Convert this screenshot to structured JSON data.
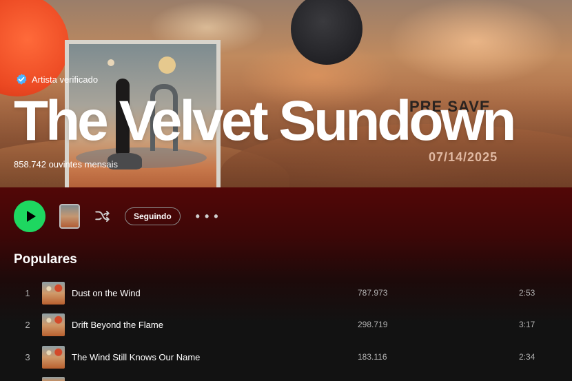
{
  "artist": {
    "verified_label": "Artista verificado",
    "name": "The Velvet Sundown",
    "monthly_listeners": "858.742 ouvintes mensais"
  },
  "banner": {
    "promo_headline": "PRE SAVE",
    "promo_date": "07/14/2025"
  },
  "actions": {
    "follow_label": "Seguindo",
    "more_label": "• • •"
  },
  "popular": {
    "title": "Populares",
    "tracks": [
      {
        "rank": "1",
        "title": "Dust on the Wind",
        "plays": "787.973",
        "duration": "2:53"
      },
      {
        "rank": "2",
        "title": "Drift Beyond the Flame",
        "plays": "298.719",
        "duration": "3:17"
      },
      {
        "rank": "3",
        "title": "The Wind Still Knows Our Name",
        "plays": "183.116",
        "duration": "2:34"
      }
    ]
  },
  "colors": {
    "play_button": "#1ed760",
    "header_gradient_top": "#520707",
    "background": "#121212"
  },
  "icons": [
    "verified-badge-icon",
    "play-icon",
    "shuffle-icon",
    "more-options-icon"
  ]
}
